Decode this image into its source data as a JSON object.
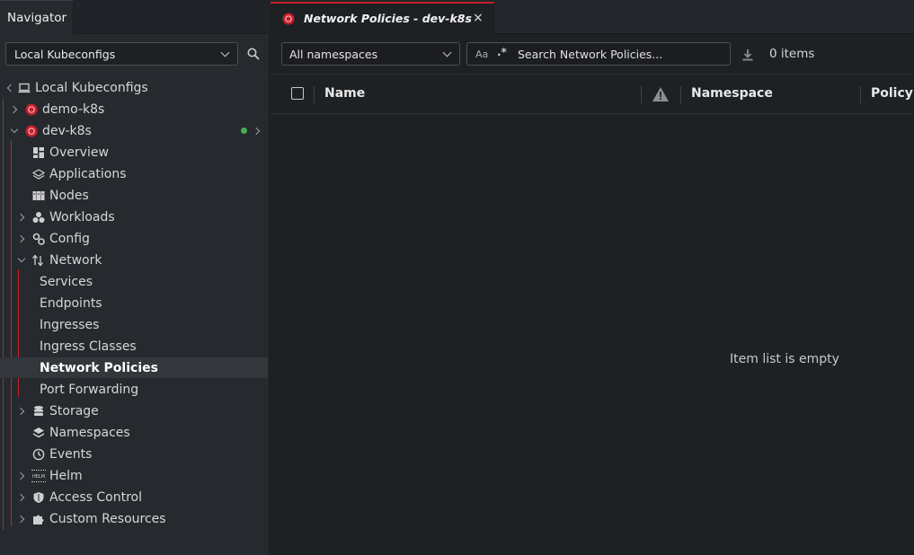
{
  "sidebar": {
    "tab_label": "Navigator",
    "cluster_select": "Local Kubeconfigs",
    "root_label": "Local Kubeconfigs",
    "clusters": [
      {
        "label": "demo-k8s"
      },
      {
        "label": "dev-k8s"
      }
    ],
    "items": {
      "overview": "Overview",
      "applications": "Applications",
      "nodes": "Nodes",
      "workloads": "Workloads",
      "config": "Config",
      "network": "Network",
      "services": "Services",
      "endpoints": "Endpoints",
      "ingresses": "Ingresses",
      "ingress_classes": "Ingress Classes",
      "network_policies": "Network Policies",
      "port_forwarding": "Port Forwarding",
      "storage": "Storage",
      "namespaces": "Namespaces",
      "events": "Events",
      "helm": "Helm",
      "access_control": "Access Control",
      "custom_resources": "Custom Resources"
    },
    "helm_icon_text": "HELM"
  },
  "main": {
    "tab_title": "Network Policies - dev-k8s",
    "tab_close": "×",
    "namespace_select": "All namespaces",
    "search": {
      "case_label": "Aa",
      "regex_label": ".*",
      "placeholder": "Search Network Policies..."
    },
    "items_count": "0 items",
    "columns": [
      "Name",
      "Namespace",
      "Policy T"
    ],
    "empty_message": "Item list is empty"
  },
  "colors": {
    "accent": "#c4202a",
    "status_ok": "#48b04e",
    "background": "#1e2124",
    "sidebar_bg": "#262a2e"
  }
}
